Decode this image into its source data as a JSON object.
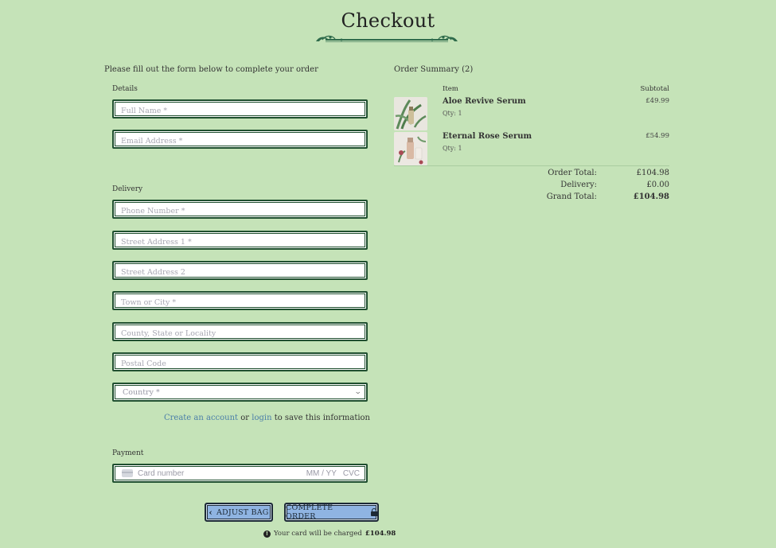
{
  "page": {
    "title": "Checkout",
    "intro": "Please fill out the form below to complete your order"
  },
  "details": {
    "label": "Details",
    "full_name_placeholder": "Full Name *",
    "email_placeholder": "Email Address *"
  },
  "delivery": {
    "label": "Delivery",
    "phone_placeholder": "Phone Number *",
    "street1_placeholder": "Street Address 1 *",
    "street2_placeholder": "Street Address 2",
    "town_placeholder": "Town or City *",
    "county_placeholder": "County, State or Locality",
    "postcode_placeholder": "Postal Code",
    "country_selected": "Country *",
    "save_create_link": "Create an account",
    "save_or": "or",
    "save_login_link": "login",
    "save_suffix": "to save this information"
  },
  "payment": {
    "label": "Payment",
    "card_number_placeholder": "Card number",
    "card_expiry_placeholder": "MM / YY",
    "card_cvc_placeholder": "CVC"
  },
  "actions": {
    "adjust_bag_label": "ADJUST BAG",
    "complete_order_label": "COMPLETE ORDER",
    "charge_note_prefix": "Your card will be charged",
    "charge_amount": "£104.98"
  },
  "summary": {
    "title": "Order Summary (2)",
    "col_item": "Item",
    "col_subtotal": "Subtotal",
    "items": [
      {
        "name": "Aloe Revive Serum",
        "qty": "Qty: 1",
        "price": "£49.99"
      },
      {
        "name": "Eternal Rose Serum",
        "qty": "Qty: 1",
        "price": "£54.99"
      }
    ],
    "order_total_label": "Order Total:",
    "order_total_value": "£104.98",
    "delivery_label": "Delivery:",
    "delivery_value": "£0.00",
    "grand_total_label": "Grand Total:",
    "grand_total_value": "£104.98"
  },
  "colors": {
    "background": "#c5e3b8",
    "field_border": "#1f4f2f",
    "button_fill": "#8fb4e2",
    "link": "#4b7fa8"
  }
}
